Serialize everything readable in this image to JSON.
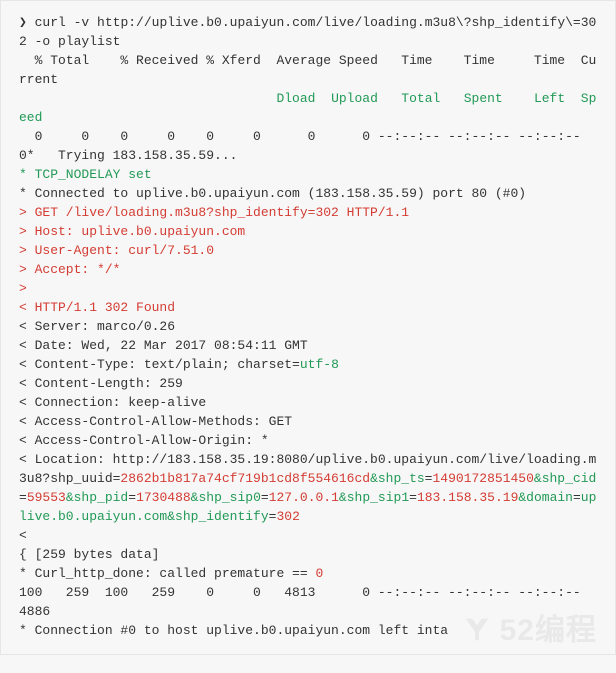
{
  "code": {
    "segments": [
      {
        "cls": "",
        "text": "❯ curl -v http://uplive.b0.upaiyun.com/live/loading.m3u8\\?shp_identify\\=302 -o playlist\n  % Total    % Received % Xferd  Average Speed   Time    Time     Time  Current\n"
      },
      {
        "cls": "",
        "text": "                                 "
      },
      {
        "cls": "hl-green",
        "text": "Dload"
      },
      {
        "cls": "",
        "text": "  "
      },
      {
        "cls": "hl-green",
        "text": "Upload"
      },
      {
        "cls": "",
        "text": "   "
      },
      {
        "cls": "hl-green",
        "text": "Total"
      },
      {
        "cls": "",
        "text": "   "
      },
      {
        "cls": "hl-green",
        "text": "Spent"
      },
      {
        "cls": "",
        "text": "    "
      },
      {
        "cls": "hl-green",
        "text": "Left"
      },
      {
        "cls": "",
        "text": "  "
      },
      {
        "cls": "hl-green",
        "text": "Speed"
      },
      {
        "cls": "",
        "text": "\n  0     0    0     0    0     0      0      0 --:--:-- --:--:-- --:--:--     0*   Trying 183.158.35.59...\n"
      },
      {
        "cls": "hl-green",
        "text": "* TCP_NODELAY set"
      },
      {
        "cls": "",
        "text": "\n* Connected to uplive.b0.upaiyun.com (183.158.35.59) port 80 (#0)\n"
      },
      {
        "cls": "hl-red",
        "text": "> GET /live/loading.m3u8?shp_identify=302 HTTP/1.1"
      },
      {
        "cls": "",
        "text": "\n"
      },
      {
        "cls": "hl-red",
        "text": "> Host: uplive.b0.upaiyun.com"
      },
      {
        "cls": "",
        "text": "\n"
      },
      {
        "cls": "hl-red",
        "text": "> User-Agent: curl/7.51.0"
      },
      {
        "cls": "",
        "text": "\n"
      },
      {
        "cls": "hl-red",
        "text": "> Accept: */*"
      },
      {
        "cls": "",
        "text": "\n"
      },
      {
        "cls": "hl-red",
        "text": ">"
      },
      {
        "cls": "",
        "text": "\n"
      },
      {
        "cls": "hl-red",
        "text": "< HTTP/1.1 302 Found"
      },
      {
        "cls": "",
        "text": "\n< Server: marco/0.26\n< Date: Wed, 22 Mar 2017 08:54:11 GMT\n< Content-Type: text/plain; charset="
      },
      {
        "cls": "hl-green",
        "text": "utf-8"
      },
      {
        "cls": "",
        "text": "\n< Content-Length: 259\n< Connection: keep-alive\n< Access-Control-Allow-Methods: GET\n< Access-Control-Allow-Origin: *\n< Location: http://183.158.35.19:8080/uplive.b0.upaiyun.com/live/loading.m3u8?shp_uuid="
      },
      {
        "cls": "hl-red",
        "text": "2862b1b817a74cf719b1cd8f554616cd"
      },
      {
        "cls": "hl-green",
        "text": "&shp_ts"
      },
      {
        "cls": "",
        "text": "="
      },
      {
        "cls": "hl-red",
        "text": "1490172851450"
      },
      {
        "cls": "hl-green",
        "text": "&shp_cid"
      },
      {
        "cls": "",
        "text": "="
      },
      {
        "cls": "hl-red",
        "text": "59553"
      },
      {
        "cls": "hl-green",
        "text": "&shp_pid"
      },
      {
        "cls": "",
        "text": "="
      },
      {
        "cls": "hl-red",
        "text": "1730488"
      },
      {
        "cls": "hl-green",
        "text": "&shp_sip0"
      },
      {
        "cls": "",
        "text": "="
      },
      {
        "cls": "hl-red",
        "text": "127.0.0.1"
      },
      {
        "cls": "hl-green",
        "text": "&shp_sip1"
      },
      {
        "cls": "",
        "text": "="
      },
      {
        "cls": "hl-red",
        "text": "183.158.35.19"
      },
      {
        "cls": "hl-green",
        "text": "&domain"
      },
      {
        "cls": "",
        "text": "="
      },
      {
        "cls": "hl-green",
        "text": "uplive.b0.upaiyun.com"
      },
      {
        "cls": "hl-green",
        "text": "&shp_identify"
      },
      {
        "cls": "",
        "text": "="
      },
      {
        "cls": "hl-red",
        "text": "302"
      },
      {
        "cls": "",
        "text": "\n<\n{ [259 bytes data]\n* Curl_http_done: called premature == "
      },
      {
        "cls": "hl-red",
        "text": "0"
      },
      {
        "cls": "",
        "text": "\n100   259  100   259    0     0   4813      0 --:--:-- --:--:-- --:--:--  4886\n* Connection #0 to host uplive.b0.upaiyun.com left inta"
      }
    ]
  },
  "watermark": {
    "text": "52编程"
  }
}
